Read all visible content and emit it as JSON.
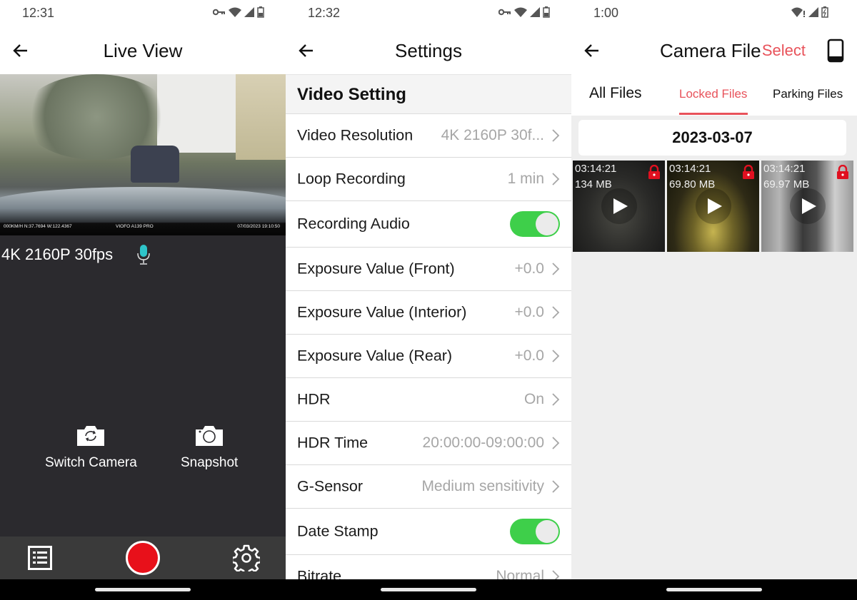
{
  "colors": {
    "accent_red": "#e8525a",
    "record_red": "#e8101a",
    "toggle_green": "#3ecf4a",
    "mic_teal": "#2ec4c9",
    "dark_panel": "#2b2a2e",
    "bottom_bar": "#3a3a3a"
  },
  "live_view": {
    "status_time": "12:31",
    "status_icons": [
      "vpn-key-icon",
      "wifi-icon",
      "cell-signal-icon",
      "battery-icon"
    ],
    "title": "Live View",
    "video_overlay": {
      "speed_gps": "000KM/H  N:37.7694  W:122.4367",
      "model": "VIOFO  A139  PRO",
      "datetime": "07/03/2023   19:10:50"
    },
    "resolution": "4K 2160P 30fps",
    "mic_icon": "microphone-icon",
    "actions": [
      {
        "label": "Switch Camera",
        "icon": "switch-camera-icon"
      },
      {
        "label": "Snapshot",
        "icon": "camera-icon"
      }
    ],
    "bottom_bar": [
      "file-list-icon",
      "record-button",
      "settings-gear-icon"
    ]
  },
  "settings": {
    "status_time": "12:32",
    "status_icons": [
      "vpn-key-icon",
      "wifi-icon",
      "cell-signal-icon",
      "battery-icon"
    ],
    "title": "Settings",
    "section_title": "Video Setting",
    "items": [
      {
        "label": "Video Resolution",
        "value": "4K 2160P 30f...",
        "type": "chevron"
      },
      {
        "label": "Loop Recording",
        "value": "1 min",
        "type": "chevron"
      },
      {
        "label": "Recording Audio",
        "value": "on",
        "type": "toggle"
      },
      {
        "label": "Exposure Value (Front)",
        "value": "+0.0",
        "type": "chevron"
      },
      {
        "label": "Exposure Value (Interior)",
        "value": "+0.0",
        "type": "chevron"
      },
      {
        "label": "Exposure Value (Rear)",
        "value": "+0.0",
        "type": "chevron"
      },
      {
        "label": "HDR",
        "value": "On",
        "type": "chevron"
      },
      {
        "label": "HDR Time",
        "value": "20:00:00-09:00:00",
        "type": "chevron"
      },
      {
        "label": "G-Sensor",
        "value": "Medium sensitivity",
        "type": "chevron"
      },
      {
        "label": "Date Stamp",
        "value": "on",
        "type": "toggle"
      },
      {
        "label": "Bitrate",
        "value": "Normal",
        "type": "chevron"
      }
    ]
  },
  "camera_files": {
    "status_time": "1:00",
    "status_icons": [
      "wifi-no-internet-icon",
      "cell-signal-icon",
      "battery-charging-icon"
    ],
    "title": "Camera File",
    "select_label": "Select",
    "tabs": [
      {
        "label": "All Files",
        "active": false
      },
      {
        "label": "Locked Files",
        "active": true
      },
      {
        "label": "Parking Files",
        "active": false
      }
    ],
    "date_header": "2023-03-07",
    "files": [
      {
        "time": "03:14:21",
        "size": "134 MB",
        "locked": true
      },
      {
        "time": "03:14:21",
        "size": "69.80 MB",
        "locked": true
      },
      {
        "time": "03:14:21",
        "size": "69.97 MB",
        "locked": true
      }
    ]
  }
}
